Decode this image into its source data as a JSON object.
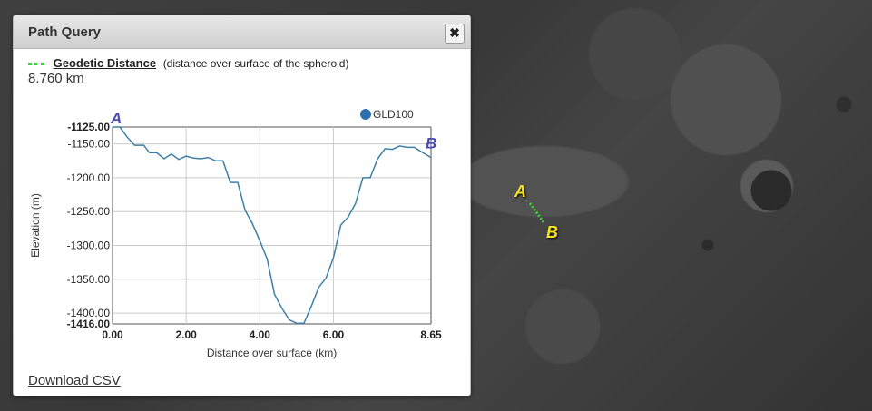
{
  "panel": {
    "title": "Path Query",
    "close_symbol": "✖",
    "distance_label": "Geodetic Distance",
    "distance_desc": "(distance over surface of the spheroid)",
    "distance_value": "8.760 km",
    "download_label": "Download CSV"
  },
  "map": {
    "label_a": "A",
    "label_b": "B",
    "line_color": "#3ccf3c"
  },
  "chart_data": {
    "type": "line",
    "xlabel": "Distance over surface (km)",
    "ylabel": "Elevation (m)",
    "xlim": [
      0,
      8.65
    ],
    "ylim": [
      -1416,
      -1125
    ],
    "x_ticks": [
      "0.00",
      "2.00",
      "4.00",
      "6.00",
      "8.65"
    ],
    "x_tick_values": [
      0,
      2,
      4,
      6,
      8.65
    ],
    "y_ticks": [
      "-1125.00",
      "-1150.00",
      "-1200.00",
      "-1250.00",
      "-1300.00",
      "-1350.00",
      "-1400.00",
      "-1416.00"
    ],
    "y_tick_values": [
      -1125,
      -1150,
      -1200,
      -1250,
      -1300,
      -1350,
      -1400,
      -1416
    ],
    "grid": true,
    "legend_position": "top-right",
    "start_label": "A",
    "end_label": "B",
    "series": [
      {
        "name": "GLD100",
        "color": "#3f7fa6",
        "legend_color": "#2b6fb0",
        "x": [
          0.0,
          0.2,
          0.4,
          0.6,
          0.85,
          1.0,
          1.2,
          1.4,
          1.6,
          1.8,
          2.0,
          2.2,
          2.4,
          2.6,
          2.8,
          3.0,
          3.2,
          3.4,
          3.6,
          3.8,
          4.0,
          4.2,
          4.4,
          4.6,
          4.8,
          5.0,
          5.2,
          5.4,
          5.6,
          5.8,
          6.0,
          6.2,
          6.4,
          6.6,
          6.8,
          7.0,
          7.2,
          7.4,
          7.6,
          7.8,
          8.0,
          8.2,
          8.4,
          8.65
        ],
        "y": [
          -1125,
          -1125,
          -1140,
          -1152,
          -1152,
          -1163,
          -1163,
          -1172,
          -1165,
          -1173,
          -1168,
          -1171,
          -1172,
          -1170,
          -1175,
          -1175,
          -1207,
          -1207,
          -1248,
          -1268,
          -1293,
          -1320,
          -1372,
          -1393,
          -1410,
          -1415,
          -1415,
          -1390,
          -1362,
          -1348,
          -1318,
          -1270,
          -1258,
          -1238,
          -1200,
          -1200,
          -1172,
          -1157,
          -1158,
          -1153,
          -1155,
          -1155,
          -1162,
          -1170
        ]
      }
    ]
  }
}
